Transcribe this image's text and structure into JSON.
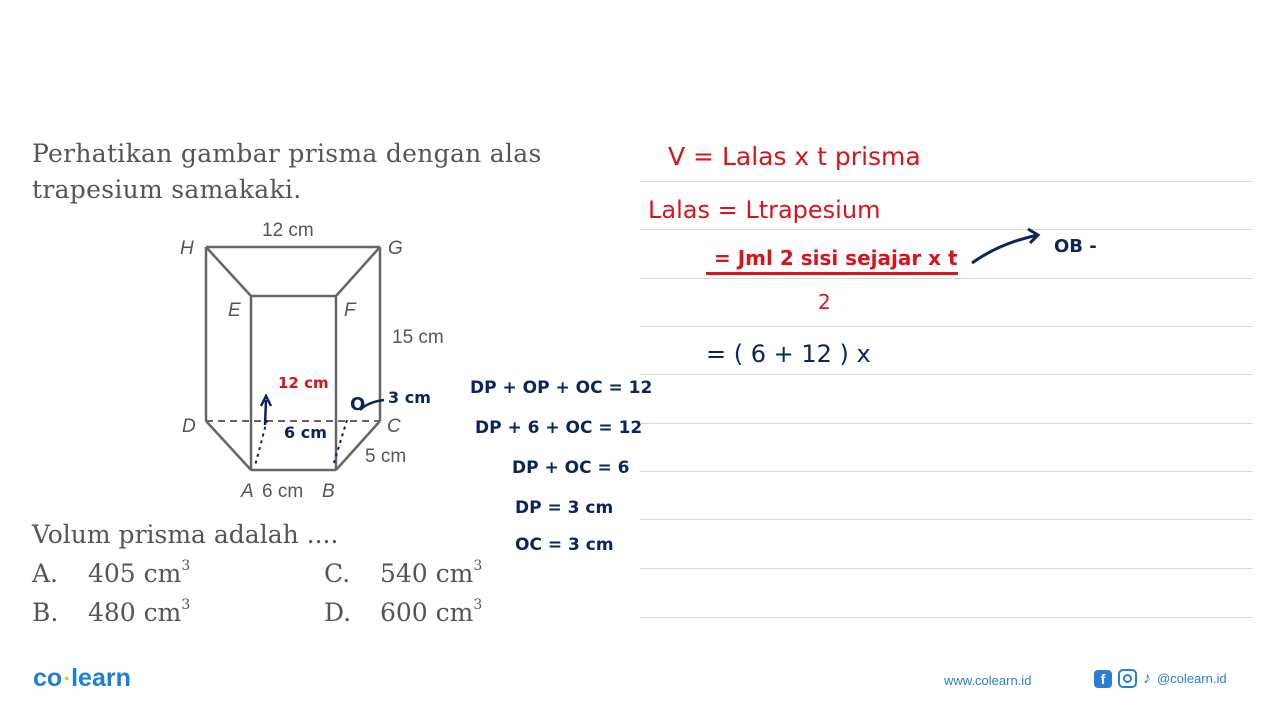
{
  "question": {
    "lines": [
      "Perhatikan gambar prisma dengan alas",
      "trapesium samakaki."
    ],
    "prompt": "Volum prisma adalah ....",
    "options": [
      {
        "key": "A.",
        "value": "405 cm",
        "exp": "3"
      },
      {
        "key": "B.",
        "value": "480 cm",
        "exp": "3"
      },
      {
        "key": "C.",
        "value": "540 cm",
        "exp": "3"
      },
      {
        "key": "D.",
        "value": "600 cm",
        "exp": "3"
      }
    ]
  },
  "figure": {
    "vertices": {
      "H": "H",
      "G": "G",
      "E": "E",
      "F": "F",
      "D": "D",
      "C": "C",
      "A": "A",
      "B": "B"
    },
    "dimensions": {
      "top": "12 cm",
      "height": "15 cm",
      "side": "5 cm",
      "bottom": "6 cm"
    },
    "annotations": {
      "red_len": "12 cm",
      "blue_mid": "6 cm",
      "point_o": "O",
      "o_len": "3 cm"
    }
  },
  "side_work": [
    "DP + OP + OC = 12",
    "DP + 6 + OC = 12",
    "DP + OC = 6",
    "DP = 3 cm",
    "OC = 3 cm"
  ],
  "notes": {
    "line1": "V = Lalas x t prisma",
    "line2": "Lalas = Ltrapesium",
    "line3_num": "= Jml 2 sisi sejajar x t",
    "line3_den": "2",
    "arrow_note": "OB -",
    "line4": "= ( 6 + 12 ) x"
  },
  "footer": {
    "logo_left": "co",
    "logo_right": "learn",
    "url": "www.colearn.id",
    "facebook_glyph": "f",
    "tiktok_glyph": "♪",
    "handle": "@colearn.id"
  },
  "colors": {
    "red_ink": "#d7141c",
    "navy_ink": "#0c2459",
    "brand_blue": "#1e7fd6"
  }
}
